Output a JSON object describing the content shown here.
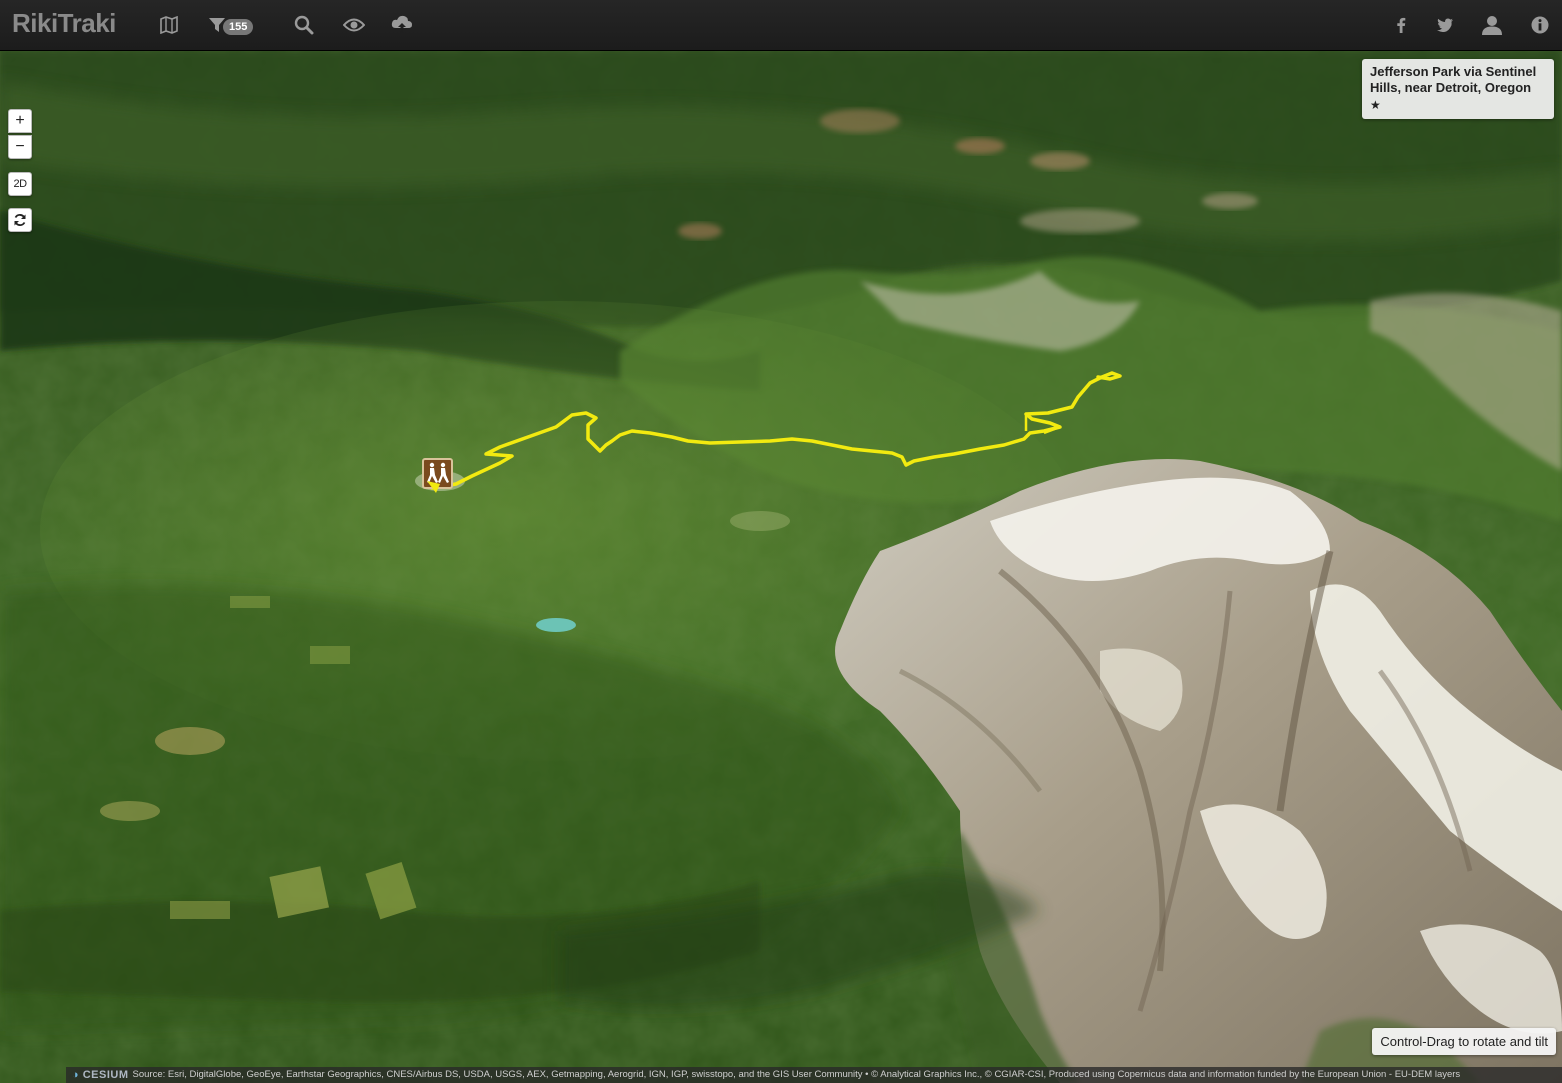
{
  "navbar": {
    "brand": "RikiTraki",
    "filter_count": "155",
    "icons": [
      "map-icon",
      "filter-icon",
      "search-icon",
      "eye-icon",
      "upload-icon",
      "facebook-icon",
      "twitter-icon",
      "user-icon",
      "info-icon"
    ]
  },
  "map_controls": {
    "zoom_in": "+",
    "zoom_out": "−",
    "mode_2d": "2D",
    "refresh_icon": "refresh-icon"
  },
  "trail": {
    "title": "Jefferson Park via Sentinel Hills, near Detroit, Oregon",
    "rating": "★",
    "track_color": "#f2ea10",
    "marker_icon": "hiker-icon"
  },
  "hint": "Control-Drag to rotate and tilt",
  "credits": {
    "logo": "CESIUM",
    "text": "Source: Esri, DigitalGlobe, GeoEye, Earthstar Geographics, CNES/Airbus DS, USDA, USGS, AEX, Getmapping, Aerogrid, IGN, IGP, swisstopo, and the GIS User Community • © Analytical Graphics Inc., © CGIAR-CSI, Produced using Copernicus data and information funded by the European Union - EU-DEM layers"
  }
}
